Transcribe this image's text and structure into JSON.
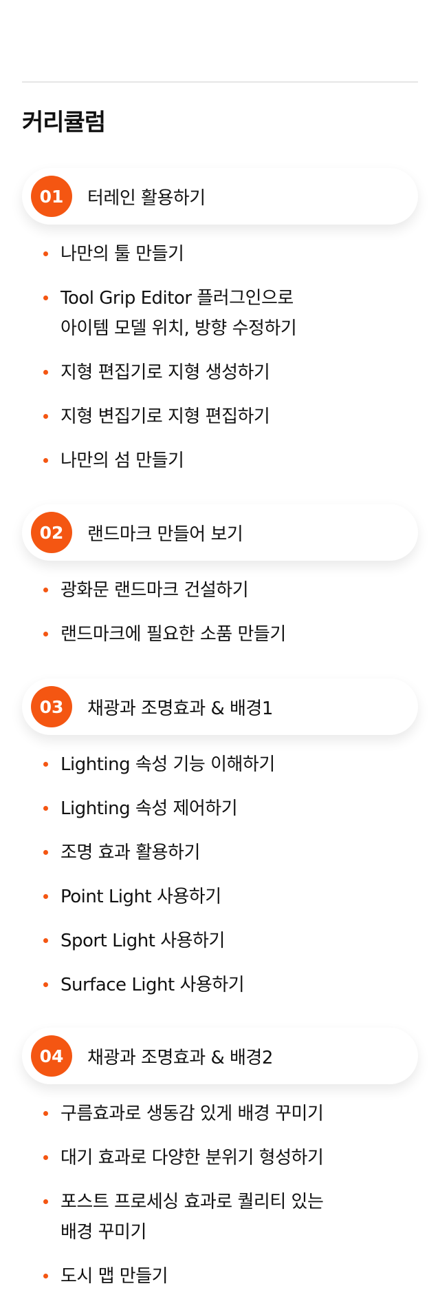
{
  "section_title": "커리큘럼",
  "accent_color": "#f45612",
  "modules": [
    {
      "number": "01",
      "title": "터레인 활용하기",
      "lessons": [
        "나만의 툴 만들기",
        "Tool Grip Editor 플러그인으로\n아이템 모델 위치, 방향 수정하기",
        "지형 편집기로 지형 생성하기",
        "지형 변집기로 지형 편집하기",
        "나만의 섬 만들기"
      ]
    },
    {
      "number": "02",
      "title": "랜드마크 만들어 보기",
      "lessons": [
        "광화문 랜드마크 건설하기",
        "랜드마크에 필요한 소품 만들기"
      ]
    },
    {
      "number": "03",
      "title": "채광과 조명효과 & 배경1",
      "lessons": [
        "Lighting 속성 기능 이해하기",
        "Lighting 속성 제어하기",
        "조명 효과 활용하기",
        "Point Light 사용하기",
        "Sport Light 사용하기",
        "Surface Light 사용하기"
      ]
    },
    {
      "number": "04",
      "title": "채광과 조명효과 & 배경2",
      "lessons": [
        "구름효과로 생동감 있게 배경 꾸미기",
        "대기 효과로 다양한 분위기 형성하기",
        "포스트 프로세싱 효과로 퀄리티 있는\n배경 꾸미기",
        "도시 맵 만들기"
      ]
    }
  ]
}
